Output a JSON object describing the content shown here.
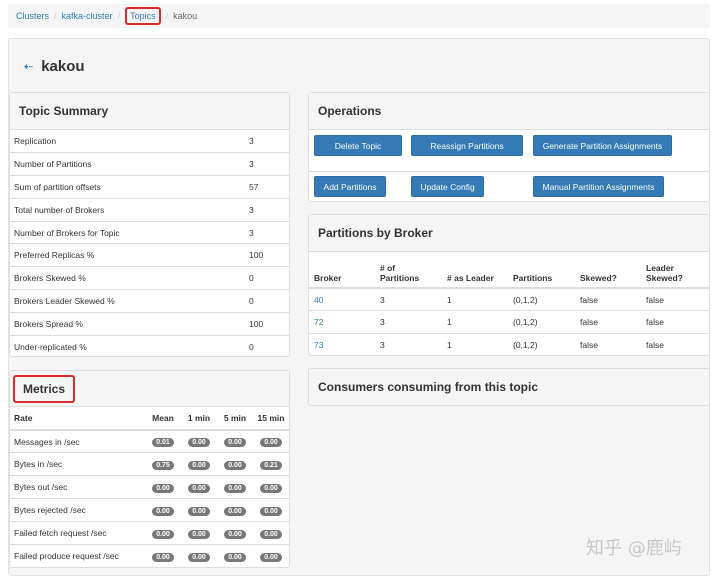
{
  "breadcrumb": {
    "clusters": "Clusters",
    "cluster": "kafka-cluster",
    "topics": "Topics",
    "current": "kakou",
    "sep": "/"
  },
  "title": {
    "arrow": "⇠",
    "text": "kakou"
  },
  "summary": {
    "heading": "Topic Summary",
    "rows": [
      {
        "label": "Replication",
        "value": "3"
      },
      {
        "label": "Number of Partitions",
        "value": "3"
      },
      {
        "label": "Sum of partition offsets",
        "value": "57"
      },
      {
        "label": "Total number of Brokers",
        "value": "3"
      },
      {
        "label": "Number of Brokers for Topic",
        "value": "3"
      },
      {
        "label": "Preferred Replicas %",
        "value": "100"
      },
      {
        "label": "Brokers Skewed %",
        "value": "0"
      },
      {
        "label": "Brokers Leader Skewed %",
        "value": "0"
      },
      {
        "label": "Brokers Spread %",
        "value": "100"
      },
      {
        "label": "Under-replicated %",
        "value": "0"
      }
    ]
  },
  "metrics": {
    "heading": "Metrics",
    "columns": [
      "Rate",
      "Mean",
      "1 min",
      "5 min",
      "15 min"
    ],
    "rows": [
      {
        "label": "Messages in /sec",
        "values": [
          "0.01",
          "0.00",
          "0.00",
          "0.00"
        ]
      },
      {
        "label": "Bytes in /sec",
        "values": [
          "0.75",
          "0.00",
          "0.00",
          "0.21"
        ]
      },
      {
        "label": "Bytes out /sec",
        "values": [
          "0.00",
          "0.00",
          "0.00",
          "0.00"
        ]
      },
      {
        "label": "Bytes rejected /sec",
        "values": [
          "0.00",
          "0.00",
          "0.00",
          "0.00"
        ]
      },
      {
        "label": "Failed fetch request /sec",
        "values": [
          "0.00",
          "0.00",
          "0.00",
          "0.00"
        ]
      },
      {
        "label": "Failed produce request /sec",
        "values": [
          "0.00",
          "0.00",
          "0.00",
          "0.00"
        ]
      }
    ]
  },
  "operations": {
    "heading": "Operations",
    "delete": "Delete Topic",
    "reassign": "Reassign Partitions",
    "generate": "Generate Partition Assignments",
    "add": "Add Partitions",
    "update": "Update Config",
    "manual": "Manual Partition Assignments"
  },
  "brokers": {
    "heading": "Partitions by Broker",
    "columns": {
      "broker": "Broker",
      "partitions_1": "# of",
      "partitions_2": "Partitions",
      "leader": "# as Leader",
      "parts": "Partitions",
      "skewed": "Skewed?",
      "leader_skewed_1": "Leader",
      "leader_skewed_2": "Skewed?"
    },
    "rows": [
      {
        "broker": "40",
        "num": "3",
        "leader": "1",
        "partitions": "(0,1,2)",
        "skewed": "false",
        "leader_skewed": "false"
      },
      {
        "broker": "72",
        "num": "3",
        "leader": "1",
        "partitions": "(0,1,2)",
        "skewed": "false",
        "leader_skewed": "false"
      },
      {
        "broker": "73",
        "num": "3",
        "leader": "1",
        "partitions": "(0,1,2)",
        "skewed": "false",
        "leader_skewed": "false"
      }
    ]
  },
  "consumers": {
    "heading": "Consumers consuming from this topic"
  },
  "watermark": "知乎 @鹿屿",
  "colors": {
    "link": "#337ab7",
    "button": "#337ab7",
    "highlight": "#d62b2b",
    "badge": "#777777"
  }
}
